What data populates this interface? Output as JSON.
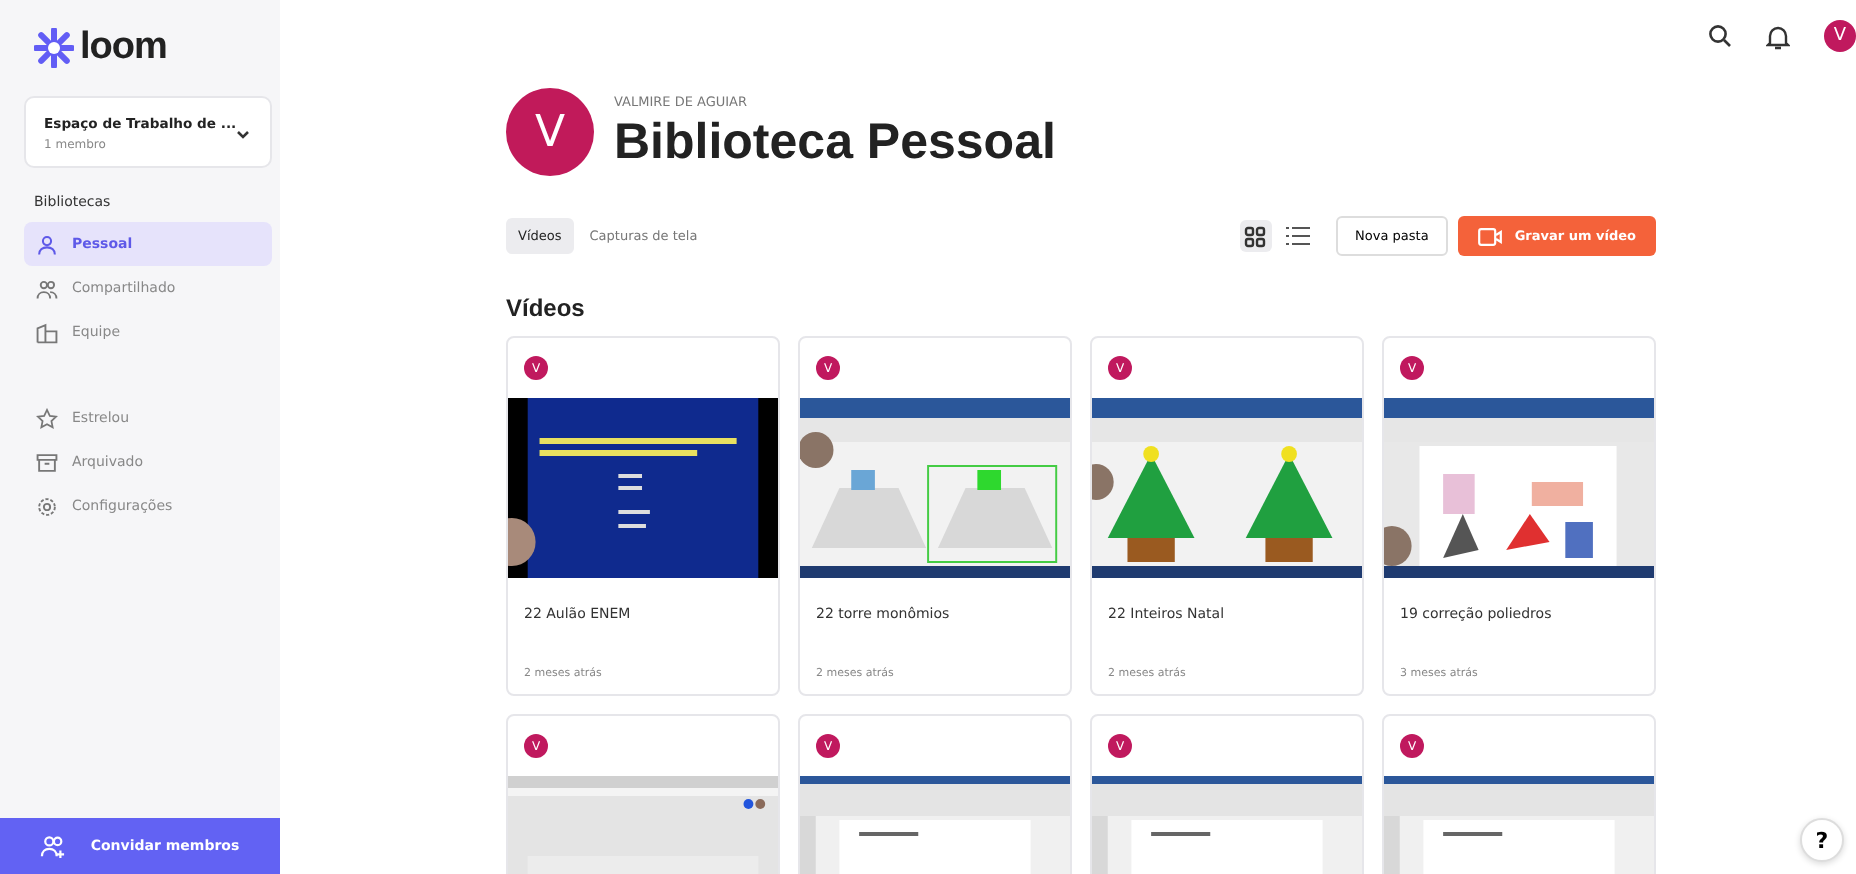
{
  "logo": "loom",
  "workspace": {
    "name": "Espaço de Trabalho de ...",
    "members": "1 membro"
  },
  "sidebar": {
    "heading": "Bibliotecas",
    "items": [
      {
        "label": "Pessoal",
        "kind": "person",
        "selected": true
      },
      {
        "label": "Compartilhado",
        "kind": "people",
        "selected": false
      },
      {
        "label": "Equipe",
        "kind": "building",
        "selected": false
      }
    ],
    "secondary": [
      {
        "label": "Estrelou",
        "kind": "star"
      },
      {
        "label": "Arquivado",
        "kind": "archive"
      },
      {
        "label": "Configurações",
        "kind": "gear"
      }
    ],
    "invite_button": "Convidar membros"
  },
  "topbar": {
    "avatar": "V"
  },
  "header": {
    "avatar": "V",
    "owner": "VALMIRE DE AGUIAR",
    "title": "Biblioteca Pessoal"
  },
  "tabs": [
    {
      "label": "Vídeos",
      "selected": true
    },
    {
      "label": "Capturas de tela",
      "selected": false
    }
  ],
  "view_toggles": [
    {
      "kind": "grid",
      "selected": true
    },
    {
      "kind": "list",
      "selected": false
    }
  ],
  "new_folder_button": "Nova pasta",
  "record_button": "Gravar um vídeo",
  "section_title": "Vídeos",
  "videos": [
    {
      "avatar": "V",
      "title": "22 Aulão ENEM",
      "age": "2 meses atrás"
    },
    {
      "avatar": "V",
      "title": "22 torre monômios",
      "age": "2 meses atrás"
    },
    {
      "avatar": "V",
      "title": "22 Inteiros Natal",
      "age": "2 meses atrás"
    },
    {
      "avatar": "V",
      "title": "19 correção poliedros",
      "age": "3 meses atrás"
    },
    {
      "avatar": "V"
    },
    {
      "avatar": "V"
    },
    {
      "avatar": "V"
    },
    {
      "avatar": "V"
    }
  ],
  "help_button": "?"
}
